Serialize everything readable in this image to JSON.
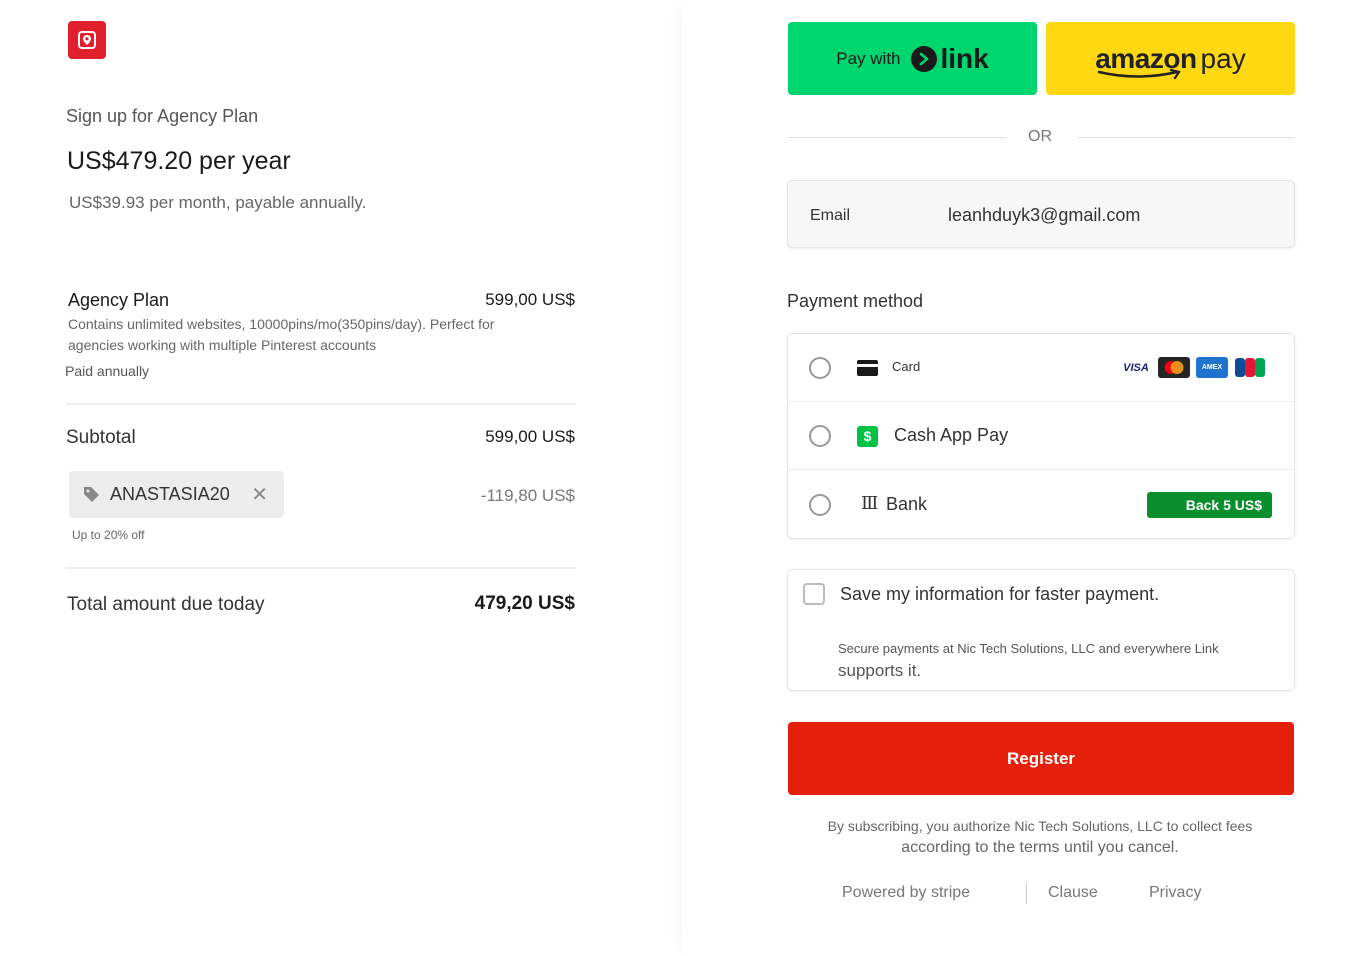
{
  "summary": {
    "plan_heading": "Sign up for Agency Plan",
    "price": "US$479.20 per year",
    "price_note": "US$39.93 per month, payable annually.",
    "item": {
      "name": "Agency Plan",
      "price": "599,00 US$",
      "description": "Contains unlimited websites, 10000pins/mo(350pins/day). Perfect for agencies working with multiple Pinterest accounts",
      "billing": "Paid annually"
    },
    "subtotal_label": "Subtotal",
    "subtotal_value": "599,00 US$",
    "coupon": {
      "code": "ANASTASIA20",
      "note": "Up to 20% off",
      "discount": "-119,80 US$"
    },
    "total_label": "Total amount due today",
    "total_value": "479,20 US$"
  },
  "checkout": {
    "link_button": {
      "prefix": "Pay with",
      "brand": "link"
    },
    "amazon_button": {
      "brand": "amazon",
      "suffix": "pay"
    },
    "or_text": "OR",
    "email": {
      "label": "Email",
      "value": "leanhduyk3@gmail.com"
    },
    "payment_method_title": "Payment method",
    "methods": [
      {
        "label": "Card",
        "brands": [
          "VISA",
          "Mastercard",
          "AMEX",
          "JCB"
        ]
      },
      {
        "label": "Cash App Pay",
        "icon": "$"
      },
      {
        "label": "Bank",
        "badge": "Back 5 US$",
        "icon": "Ⅲ"
      }
    ],
    "save_info": {
      "title": "Save my information for faster payment.",
      "desc_small": "Secure payments at Nic Tech Solutions, LLC and everywhere Link",
      "desc_big": "supports it."
    },
    "register_label": "Register",
    "legal_small": "By subscribing, you authorize Nic Tech Solutions, LLC to collect fees",
    "legal_big": "according to the terms until you cancel.",
    "footer": {
      "powered": "Powered by stripe",
      "clause": "Clause",
      "privacy": "Privacy"
    }
  },
  "colors": {
    "link_green": "#00d66f",
    "amazon_yellow": "#ffd814",
    "register_red": "#e4200b",
    "logo_red": "#e0202c",
    "badge_green": "#0a8f2e"
  }
}
